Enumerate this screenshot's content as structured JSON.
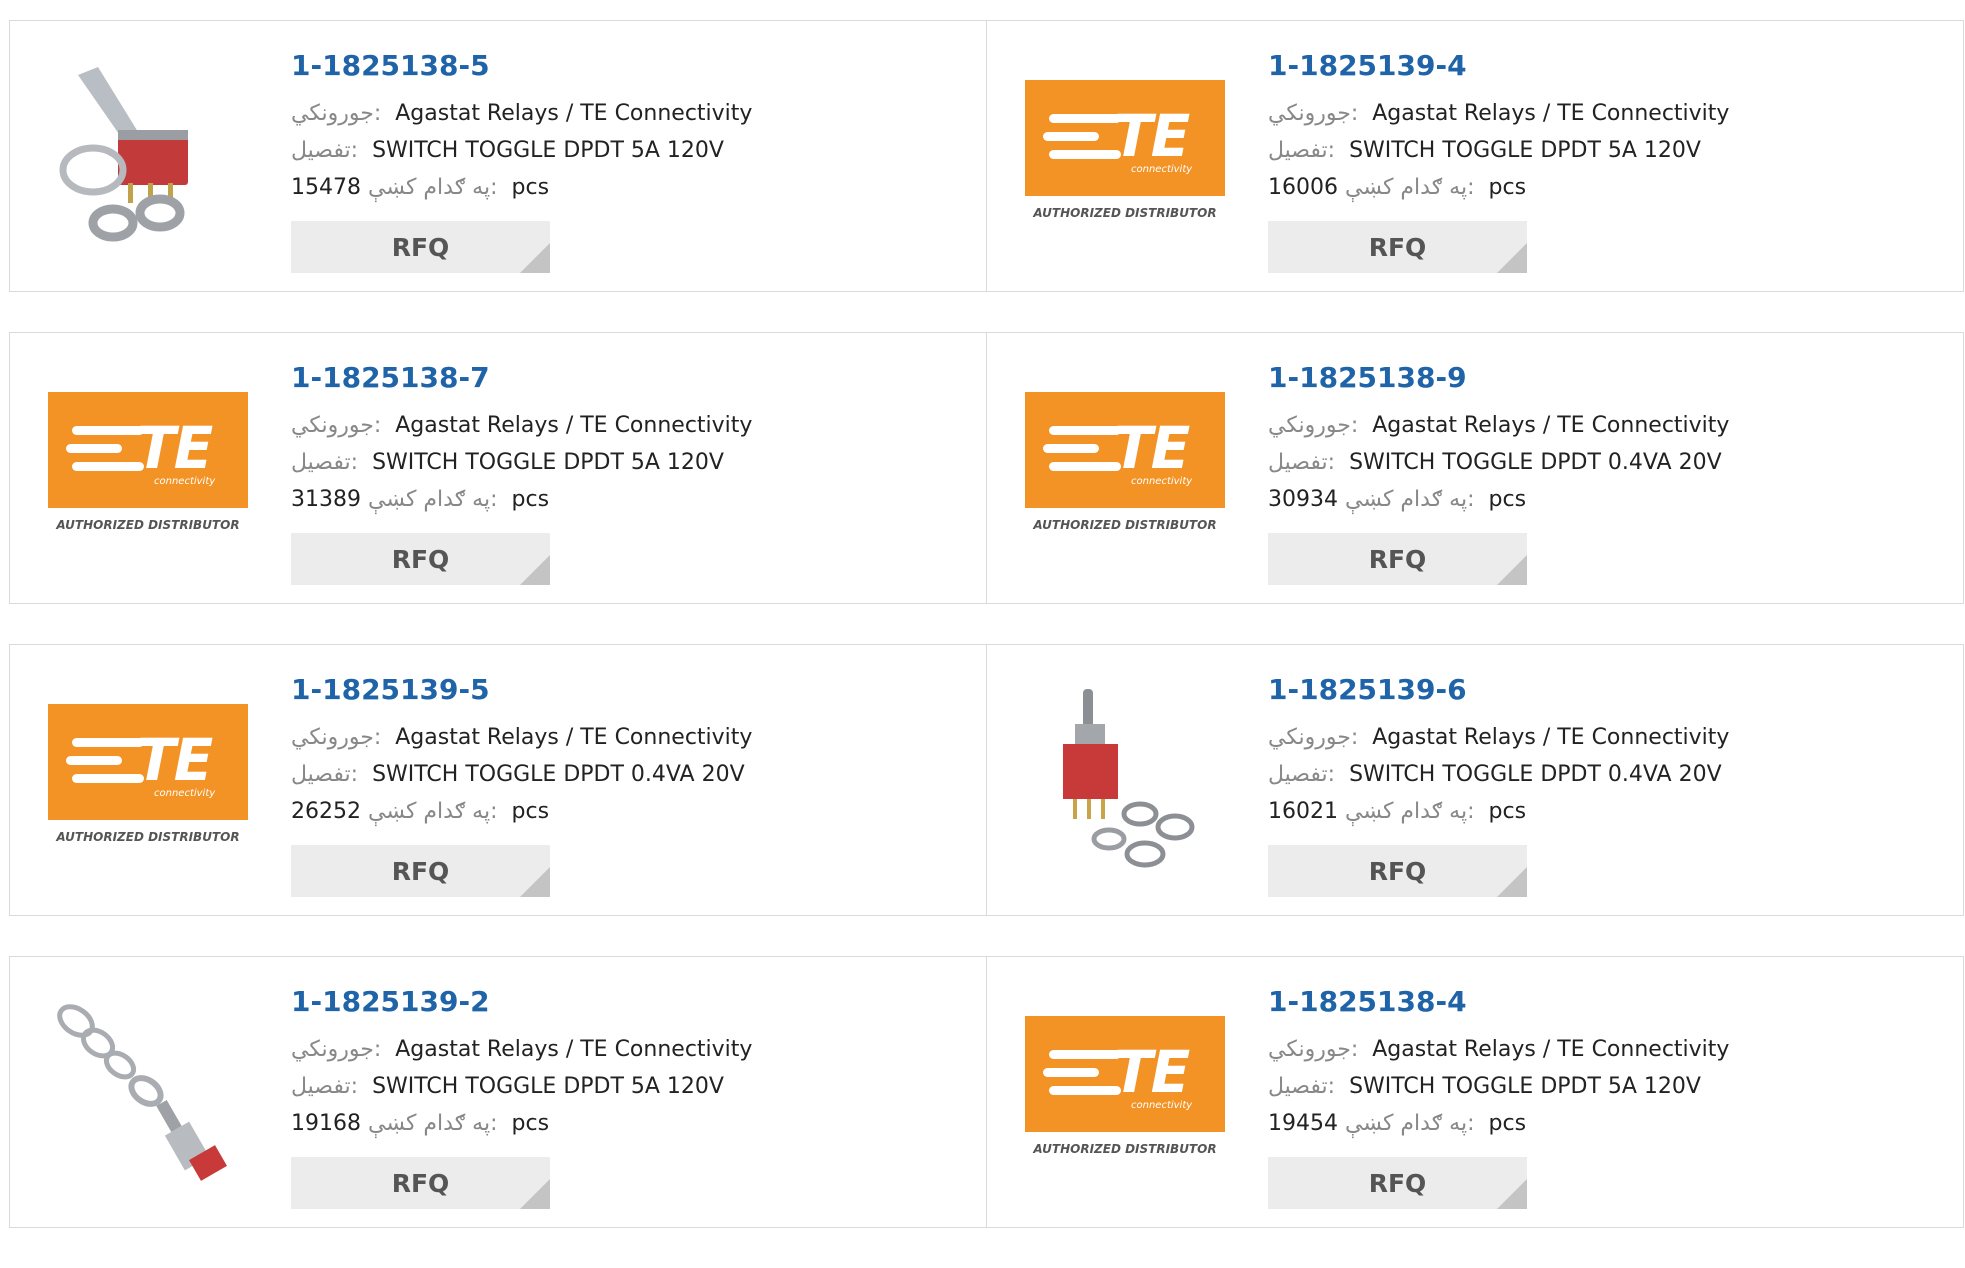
{
  "labels": {
    "manufacturer": "جورونكي:",
    "description": "تفصيل:",
    "stock": "په ګدام کښې:",
    "unit": "pcs",
    "rfq": "RFQ"
  },
  "te_logo": {
    "wordmark": "TE",
    "subtext": "connectivity",
    "tagline": "AUTHORIZED DISTRIBUTOR"
  },
  "products": [
    {
      "part": "1-1825138-5",
      "manufacturer": "Agastat Relays / TE Connectivity",
      "description": "SWITCH TOGGLE DPDT 5A 120V",
      "stock": "15478",
      "image": "toggle-switch-photo"
    },
    {
      "part": "1-1825139-4",
      "manufacturer": "Agastat Relays / TE Connectivity",
      "description": "SWITCH TOGGLE DPDT 5A 120V",
      "stock": "16006",
      "image": "te-logo"
    },
    {
      "part": "1-1825138-7",
      "manufacturer": "Agastat Relays / TE Connectivity",
      "description": "SWITCH TOGGLE DPDT 5A 120V",
      "stock": "31389",
      "image": "te-logo"
    },
    {
      "part": "1-1825138-9",
      "manufacturer": "Agastat Relays / TE Connectivity",
      "description": "SWITCH TOGGLE DPDT 0.4VA 20V",
      "stock": "30934",
      "image": "te-logo"
    },
    {
      "part": "1-1825139-5",
      "manufacturer": "Agastat Relays / TE Connectivity",
      "description": "SWITCH TOGGLE DPDT 0.4VA 20V",
      "stock": "26252",
      "image": "te-logo"
    },
    {
      "part": "1-1825139-6",
      "manufacturer": "Agastat Relays / TE Connectivity",
      "description": "SWITCH TOGGLE DPDT 0.4VA 20V",
      "stock": "16021",
      "image": "mini-toggle-switch-photo"
    },
    {
      "part": "1-1825139-2",
      "manufacturer": "Agastat Relays / TE Connectivity",
      "description": "SWITCH TOGGLE DPDT 5A 120V",
      "stock": "19168",
      "image": "toggle-switch-with-rings-photo"
    },
    {
      "part": "1-1825138-4",
      "manufacturer": "Agastat Relays / TE Connectivity",
      "description": "SWITCH TOGGLE DPDT 5A 120V",
      "stock": "19454",
      "image": "te-logo"
    }
  ],
  "colors": {
    "part_link": "#1f63a8",
    "te_orange": "#f39325",
    "rfq_bg": "#ececec",
    "card_border": "#dadada"
  }
}
